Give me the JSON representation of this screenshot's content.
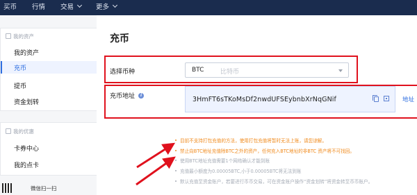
{
  "topnav": {
    "items": [
      {
        "label": "买币",
        "has_chevron": false
      },
      {
        "label": "行情",
        "has_chevron": false
      },
      {
        "label": "交易",
        "has_chevron": true
      },
      {
        "label": "更多",
        "has_chevron": true
      }
    ]
  },
  "sidebar": {
    "assets_heading": "我的资产",
    "asset_items": [
      {
        "label": "我的资产",
        "active": false
      },
      {
        "label": "充币",
        "active": true
      },
      {
        "label": "提币",
        "active": false
      },
      {
        "label": "资金划转",
        "active": false
      }
    ],
    "offers_heading": "我的优惠",
    "offer_items": [
      {
        "label": "卡券中心"
      },
      {
        "label": "我的点卡"
      }
    ],
    "wechat_label": "微信扫一扫"
  },
  "main": {
    "title": "充币",
    "select_coin": {
      "label": "选择币种",
      "value": "BTC",
      "placeholder": "比特币"
    },
    "address": {
      "label": "充币地址",
      "value": "3HmFT6sTKoMsDf2nwdUFSEybnbXrNqGNif",
      "link_label": "地址"
    },
    "notes": [
      {
        "text": "目前不支持打包充值的方法，使用打包充值将暂时无法上账，请您谅解。",
        "style": "warning"
      },
      {
        "text": "禁止向BTC地址充值除BTC之外的资产，任何充入BTC地址的非BTC 资产将不可找回。",
        "style": "warning"
      },
      {
        "text": "使用BTC地址充值需要1个网络确认才能到账",
        "style": "normal"
      },
      {
        "text": "充值最小额度为0.00005BTC,小于0.00005BTC将无法到账",
        "style": "normal"
      },
      {
        "text": "默认充值至资金账户，若要进行币币交易，可在资金账户操作“资金划转”将资金转至币币账户。",
        "style": "normal"
      }
    ]
  },
  "colors": {
    "nav_bg": "#1a2c4e",
    "accent": "#2f6fe0",
    "highlight_box": "#e0111d",
    "warning_text": "#f08a1c",
    "annotation_arrow": "#e0111d"
  },
  "icons": {
    "assets_heading": "wallet-icon",
    "offers_heading": "coupon-icon",
    "address_info": "info-icon",
    "address_copy": "copy-icon",
    "address_qr": "qr-code-icon",
    "select_caret": "chevron-down-icon"
  }
}
